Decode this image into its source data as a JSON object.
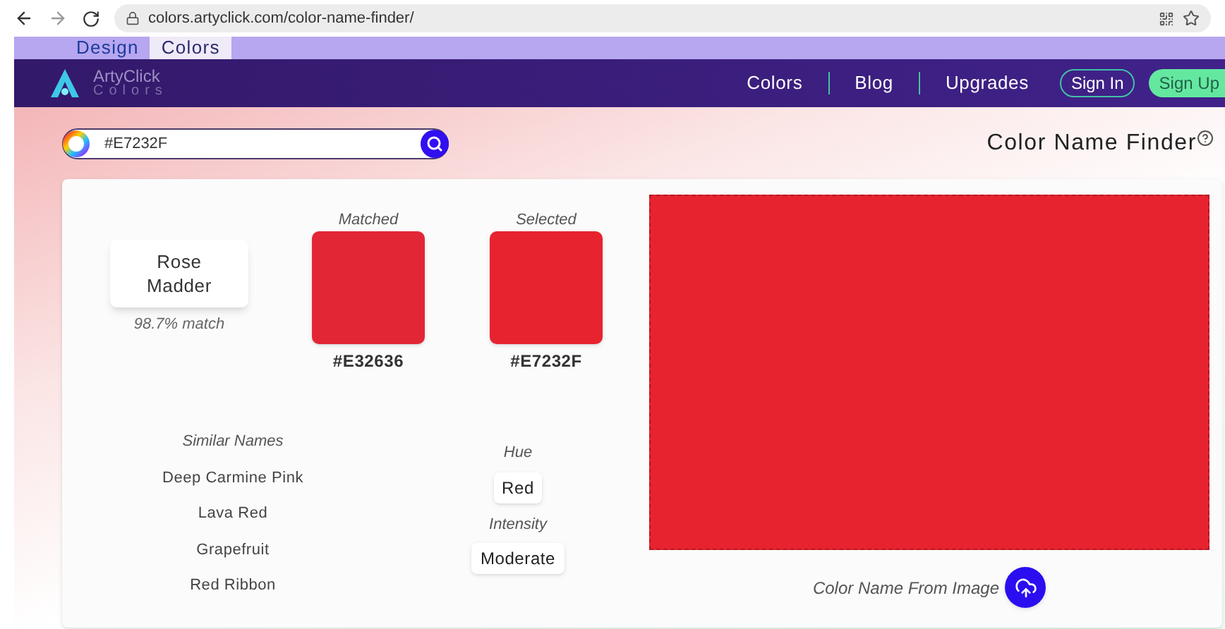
{
  "browser": {
    "url": "colors.artyclick.com/color-name-finder/"
  },
  "site_tabs": [
    {
      "label": "Design",
      "selected": false
    },
    {
      "label": "Colors",
      "selected": true
    }
  ],
  "navbar": {
    "logo_name": "ArtyClick",
    "logo_sub": "Colors",
    "links": [
      "Colors",
      "Blog",
      "Upgrades"
    ],
    "sign_in": "Sign In",
    "sign_up": "Sign Up"
  },
  "search": {
    "value": "#E7232F"
  },
  "page_title": "Color Name Finder",
  "result": {
    "name": "Rose Madder",
    "match": "98.7% match",
    "matched_label": "Matched",
    "matched_hex": "#E32636",
    "selected_label": "Selected",
    "selected_hex": "#E7232F"
  },
  "similar": {
    "title": "Similar Names",
    "names": [
      "Deep Carmine Pink",
      "Lava Red",
      "Grapefruit",
      "Red Ribbon"
    ]
  },
  "hue": {
    "label": "Hue",
    "value": "Red"
  },
  "intensity": {
    "label": "Intensity",
    "value": "Moderate"
  },
  "image_upload": {
    "label": "Color Name From Image"
  }
}
